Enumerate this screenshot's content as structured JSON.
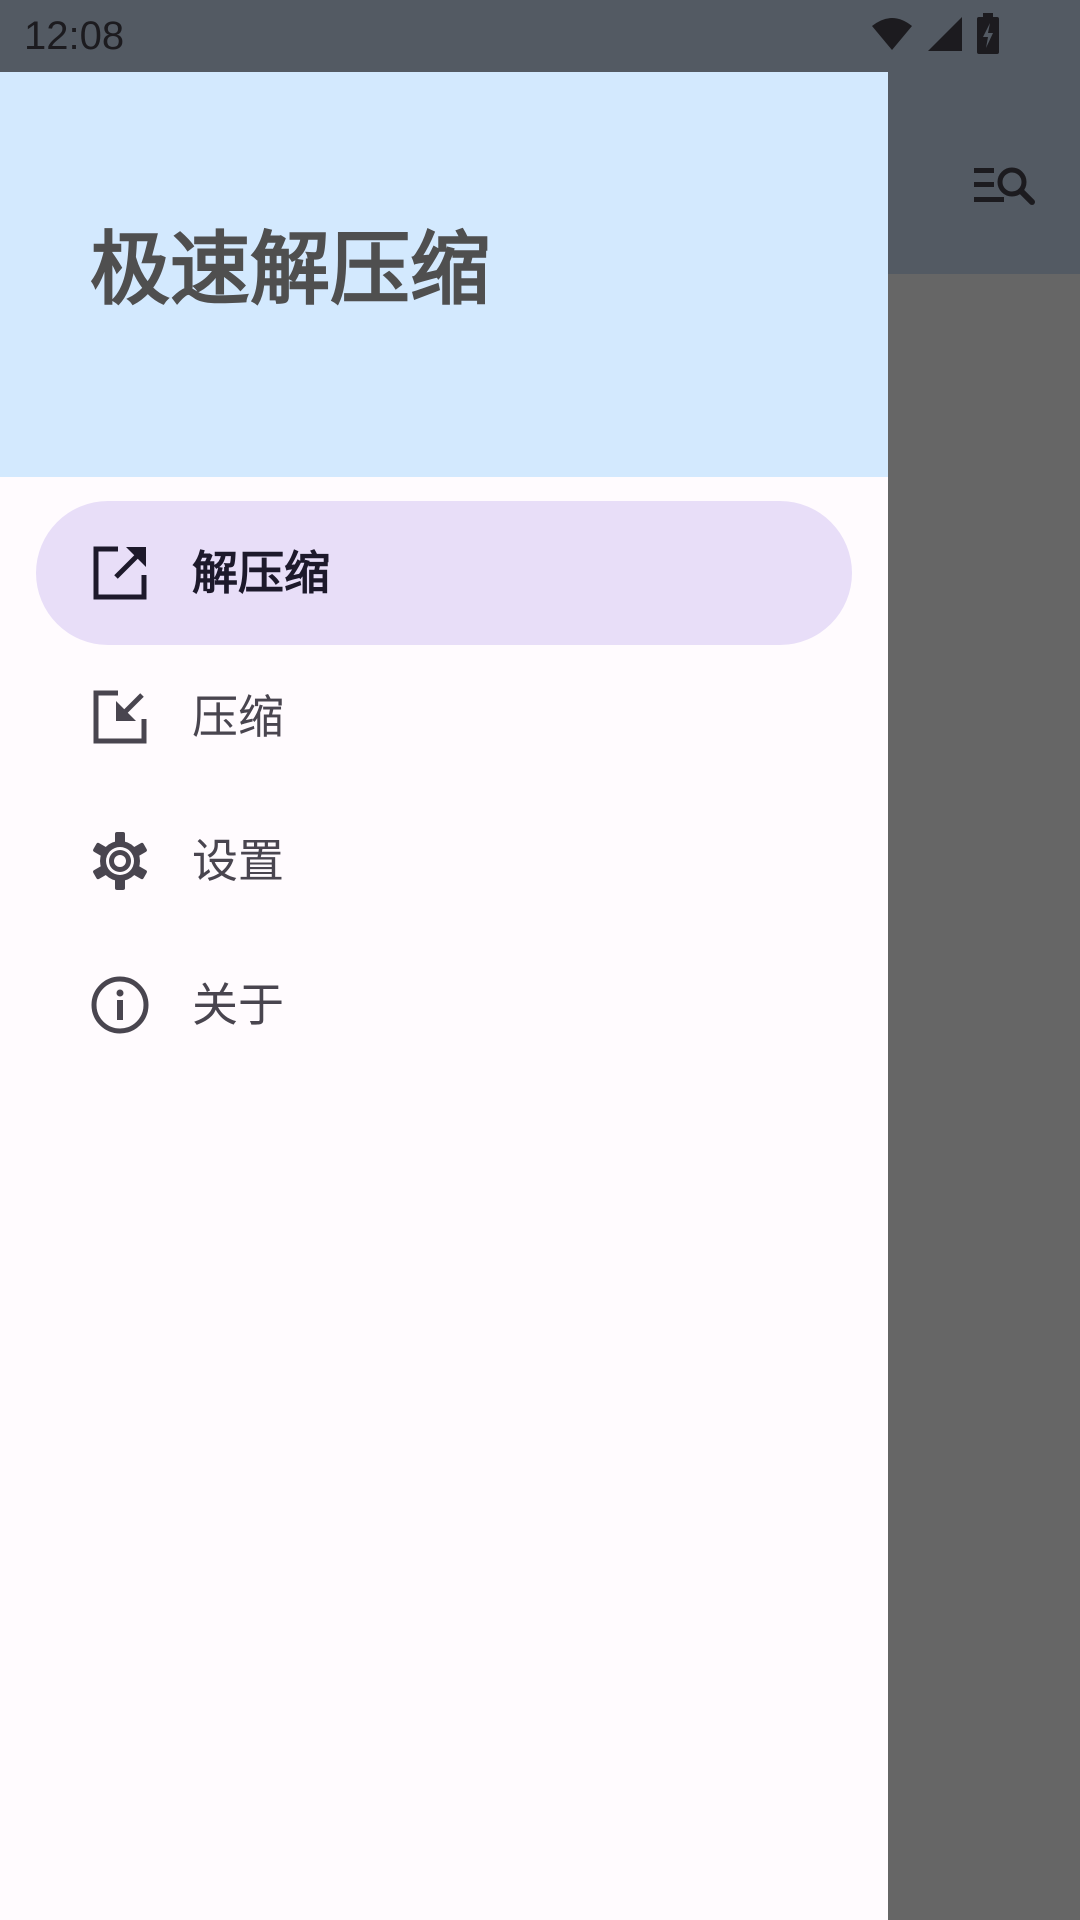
{
  "status_bar": {
    "time": "12:08",
    "icons": [
      "wifi-icon",
      "cellular-signal-icon",
      "battery-charging-icon"
    ]
  },
  "app_bar": {
    "action_icon": "filter-search-icon"
  },
  "drawer": {
    "title": "极速解压缩",
    "header_color": "#d3e9fe",
    "active_indicator_color": "#e8def8",
    "items": [
      {
        "label": "解压缩",
        "icon": "unzip-export-icon",
        "active": true
      },
      {
        "label": "压缩",
        "icon": "zip-import-icon",
        "active": false
      },
      {
        "label": "设置",
        "icon": "settings-gear-icon",
        "active": false
      },
      {
        "label": "关于",
        "icon": "info-icon",
        "active": false
      }
    ]
  },
  "colors": {
    "scrim": "#666666",
    "app_bar": "#535a63",
    "drawer_bg": "#fffbfe"
  }
}
